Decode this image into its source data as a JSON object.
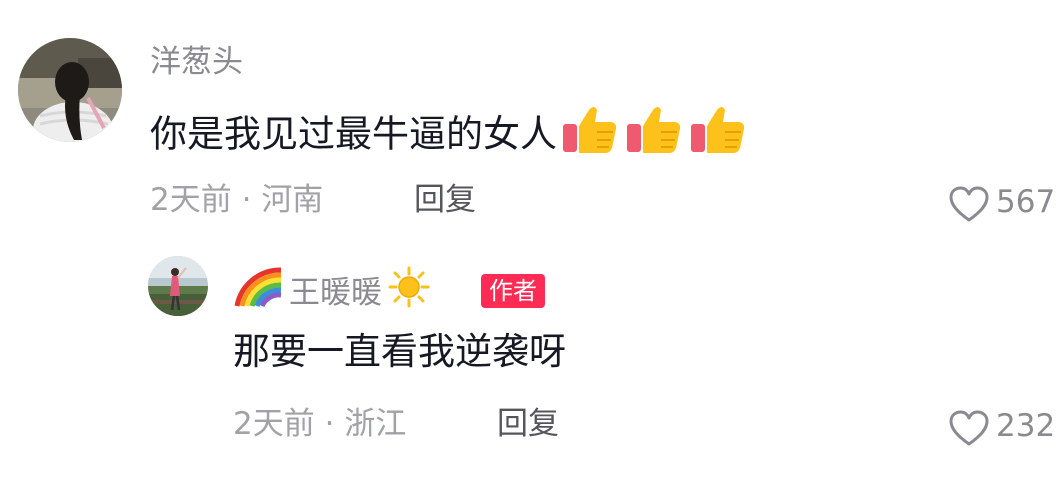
{
  "comment": {
    "username": "洋葱头",
    "text": "你是我见过最牛逼的女人",
    "emojis": [
      "thumbs-up-icon",
      "thumbs-up-icon",
      "thumbs-up-icon"
    ],
    "time": "2天前",
    "separator": "·",
    "location": "河南",
    "reply_label": "回复",
    "like_count": "567"
  },
  "reply": {
    "username": "王暖暖",
    "name_prefix_icon": "rainbow-icon",
    "name_suffix_icon": "sun-icon",
    "badge": "作者",
    "text": "那要一直看我逆袭呀",
    "time": "2天前",
    "separator": "·",
    "location": "浙江",
    "reply_label": "回复",
    "like_count": "232"
  },
  "colors": {
    "badge_bg": "#fe2c55",
    "secondary_text": "#8a8b91",
    "primary_text": "#161823"
  }
}
